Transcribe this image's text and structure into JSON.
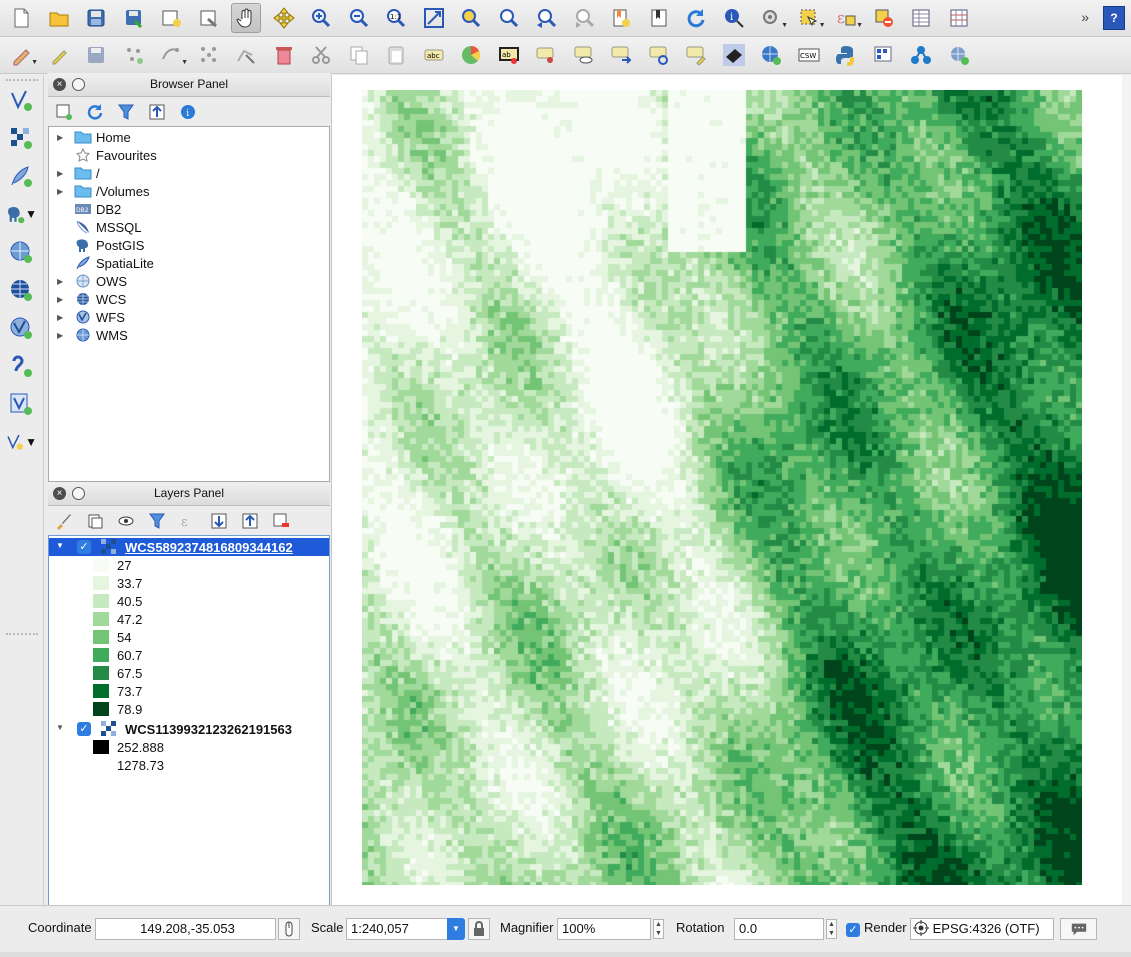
{
  "browser_panel": {
    "title": "Browser Panel",
    "items": [
      {
        "label": "Home",
        "icon": "folder-icon",
        "expandable": true
      },
      {
        "label": "Favourites",
        "icon": "star-icon",
        "expandable": false
      },
      {
        "label": "/",
        "icon": "folder-icon",
        "expandable": true
      },
      {
        "label": "/Volumes",
        "icon": "folder-icon",
        "expandable": true
      },
      {
        "label": "DB2",
        "icon": "db2-icon",
        "expandable": false
      },
      {
        "label": "MSSQL",
        "icon": "mssql-icon",
        "expandable": false
      },
      {
        "label": "PostGIS",
        "icon": "postgis-elephant-icon",
        "expandable": false
      },
      {
        "label": "SpatiaLite",
        "icon": "spatialite-feather-icon",
        "expandable": false
      },
      {
        "label": "OWS",
        "icon": "globe-icon",
        "expandable": true
      },
      {
        "label": "WCS",
        "icon": "wcs-globe-icon",
        "expandable": true
      },
      {
        "label": "WFS",
        "icon": "wfs-icon",
        "expandable": true
      },
      {
        "label": "WMS",
        "icon": "wms-globe-icon",
        "expandable": true
      }
    ]
  },
  "layers_panel": {
    "title": "Layers Panel",
    "layers": [
      {
        "name": "WCS5892374816809344162",
        "selected": true,
        "checked": true,
        "legend": [
          {
            "value": "27",
            "color": "#f7fcf5"
          },
          {
            "value": "33.7",
            "color": "#e5f5e0"
          },
          {
            "value": "40.5",
            "color": "#c7e9c0"
          },
          {
            "value": "47.2",
            "color": "#a1d99b"
          },
          {
            "value": "54",
            "color": "#74c476"
          },
          {
            "value": "60.7",
            "color": "#41ab5d"
          },
          {
            "value": "67.5",
            "color": "#238b45"
          },
          {
            "value": "73.7",
            "color": "#006d2c"
          },
          {
            "value": "78.9",
            "color": "#00441b"
          }
        ]
      },
      {
        "name": "WCS1139932123262191563",
        "selected": false,
        "checked": true,
        "legend": [
          {
            "value": "252.888",
            "color": "#000000"
          },
          {
            "value": "1278.73",
            "color": "#ffffff"
          }
        ]
      }
    ]
  },
  "statusbar": {
    "coordinate_label": "Coordinate",
    "coordinate_value": "149.208,-35.053",
    "scale_label": "Scale",
    "scale_value": "1:240,057",
    "magnifier_label": "Magnifier",
    "magnifier_value": "100%",
    "rotation_label": "Rotation",
    "rotation_value": "0.0",
    "render_label": "Render",
    "render_checked": true,
    "crs_value": "EPSG:4326 (OTF)"
  },
  "toolbar_main": [
    "new-project-icon",
    "open-project-icon",
    "save-project-icon",
    "save-as-icon",
    "new-print-composer-icon",
    "composer-manager-icon",
    "pan-icon",
    "pan-to-selection-icon",
    "zoom-in-icon",
    "zoom-out-icon",
    "zoom-actual-icon",
    "zoom-full-icon",
    "zoom-to-selection-icon",
    "zoom-to-layer-icon",
    "zoom-last-icon",
    "zoom-next-icon",
    "new-bookmark-icon",
    "show-bookmarks-icon",
    "refresh-icon",
    "identify-icon",
    "measure-icon",
    "select-icon",
    "expression-select-icon",
    "deselect-icon",
    "attribute-table-icon",
    "statistics-icon"
  ],
  "toolbar_edit": [
    "current-edits-icon",
    "toggle-editing-icon",
    "save-edits-icon",
    "add-feature-icon",
    "move-feature-icon",
    "node-tool-icon",
    "delete-selected-icon",
    "cut-features-icon",
    "copy-features-icon",
    "paste-features-icon",
    "label-icon",
    "diagram-icon",
    "pin-labels-icon",
    "highlight-pinned-icon",
    "show-hide-labels-icon",
    "move-label-icon",
    "rotate-label-icon",
    "change-label-icon",
    "georeferencer-icon",
    "metasearch-icon",
    "csw-icon",
    "python-console-icon",
    "qgis-cloud-icon",
    "processing-icon",
    "plugin-globe-icon"
  ],
  "colors": {
    "accent": "#1f5bd8",
    "checkbox": "#2f7de1",
    "ramp_low": "#f7fcf5",
    "ramp_high": "#00441b"
  }
}
